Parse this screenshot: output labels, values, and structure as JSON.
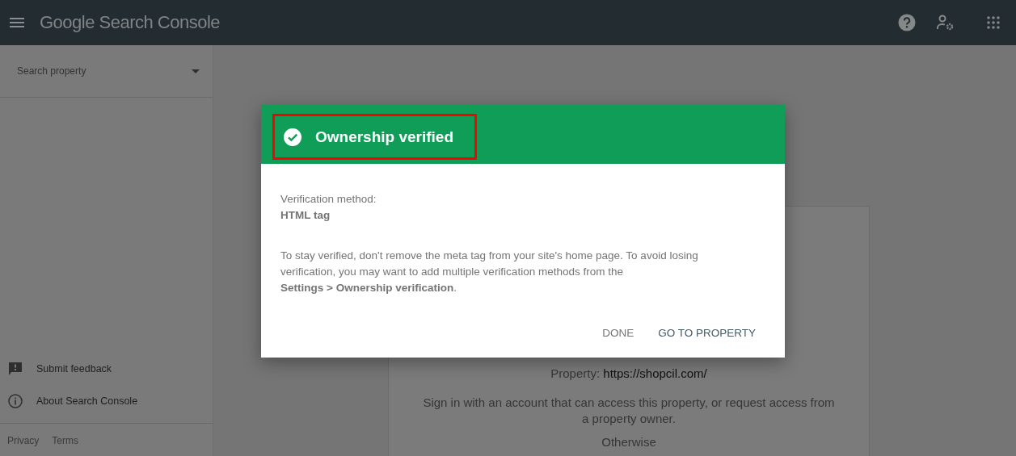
{
  "app_bar": {
    "title": "Google Search Console"
  },
  "sidebar": {
    "search": {
      "placeholder": "Search property"
    },
    "items": [
      {
        "label": "Submit feedback",
        "kind": "feedback"
      },
      {
        "label": "About Search Console",
        "kind": "info"
      }
    ],
    "footer_links": [
      "Privacy",
      "Terms"
    ]
  },
  "background_card": {
    "property_label": "Property:",
    "property_value": "https://shopcil.com/",
    "message": "Sign in with an account that can access this property, or request access from a property owner.",
    "otherwise": "Otherwise"
  },
  "dialog": {
    "title": "Ownership verified",
    "highlighted": true,
    "method_label": "Verification method:",
    "method_value": "HTML tag",
    "note": "To stay verified, don't remove the meta tag from your site's home page. To avoid losing verification, you may want to add multiple verification methods from the **Settings > Ownership verification**.",
    "buttons": [
      {
        "label": "DONE",
        "primary": false
      },
      {
        "label": "GO TO PROPERTY",
        "primary": true
      }
    ]
  }
}
